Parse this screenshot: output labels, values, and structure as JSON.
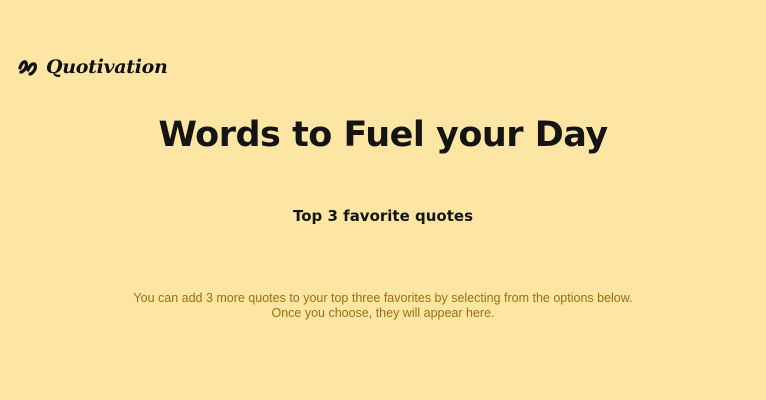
{
  "brand": {
    "name": "Quotivation",
    "icon": "quote-mark-icon"
  },
  "hero": {
    "title": "Words to Fuel your Day"
  },
  "favorites": {
    "heading": "Top 3 favorite quotes",
    "empty_line_1": "You can add 3 more quotes to your top three favorites by selecting from the options below.",
    "empty_line_2": "Once you choose, they will appear here."
  },
  "colors": {
    "background": "#fde6a3",
    "text": "#141414",
    "muted_text": "#9c6e10"
  }
}
